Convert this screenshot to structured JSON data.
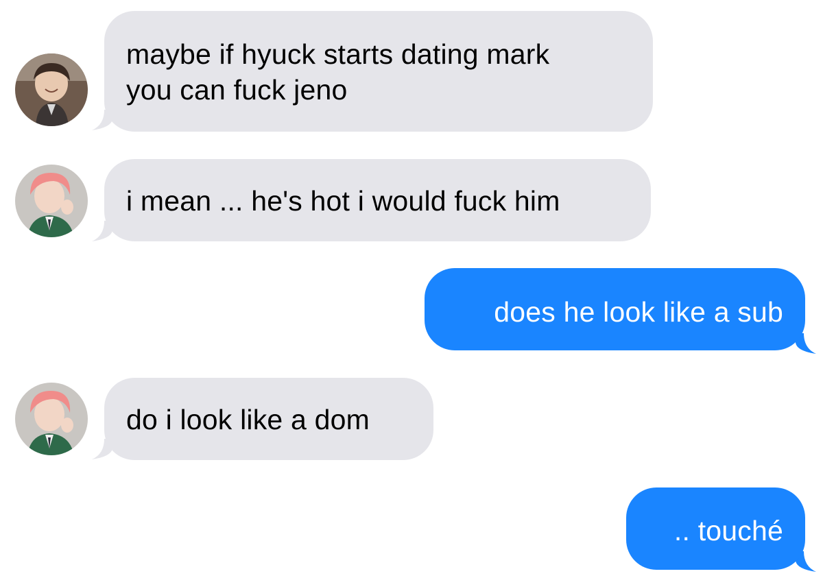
{
  "conversation": {
    "messages": [
      {
        "direction": "incoming",
        "sender_avatar": "avatar-brown-hair",
        "text_lines": [
          "maybe if hyuck starts dating mark",
          "you can fuck jeno"
        ]
      },
      {
        "direction": "incoming",
        "sender_avatar": "avatar-pink-hair",
        "text_lines": [
          "i mean ... he's hot i would fuck him"
        ]
      },
      {
        "direction": "outgoing",
        "text_lines": [
          "does he look like a sub"
        ]
      },
      {
        "direction": "incoming",
        "sender_avatar": "avatar-pink-hair",
        "text_lines": [
          "do i look like a dom"
        ]
      },
      {
        "direction": "outgoing",
        "text_lines": [
          ".. touché"
        ]
      }
    ]
  },
  "colors": {
    "incoming_bubble": "#e5e5ea",
    "outgoing_bubble": "#1a85ff",
    "incoming_text": "#000000",
    "outgoing_text": "#ffffff",
    "background": "#ffffff"
  }
}
